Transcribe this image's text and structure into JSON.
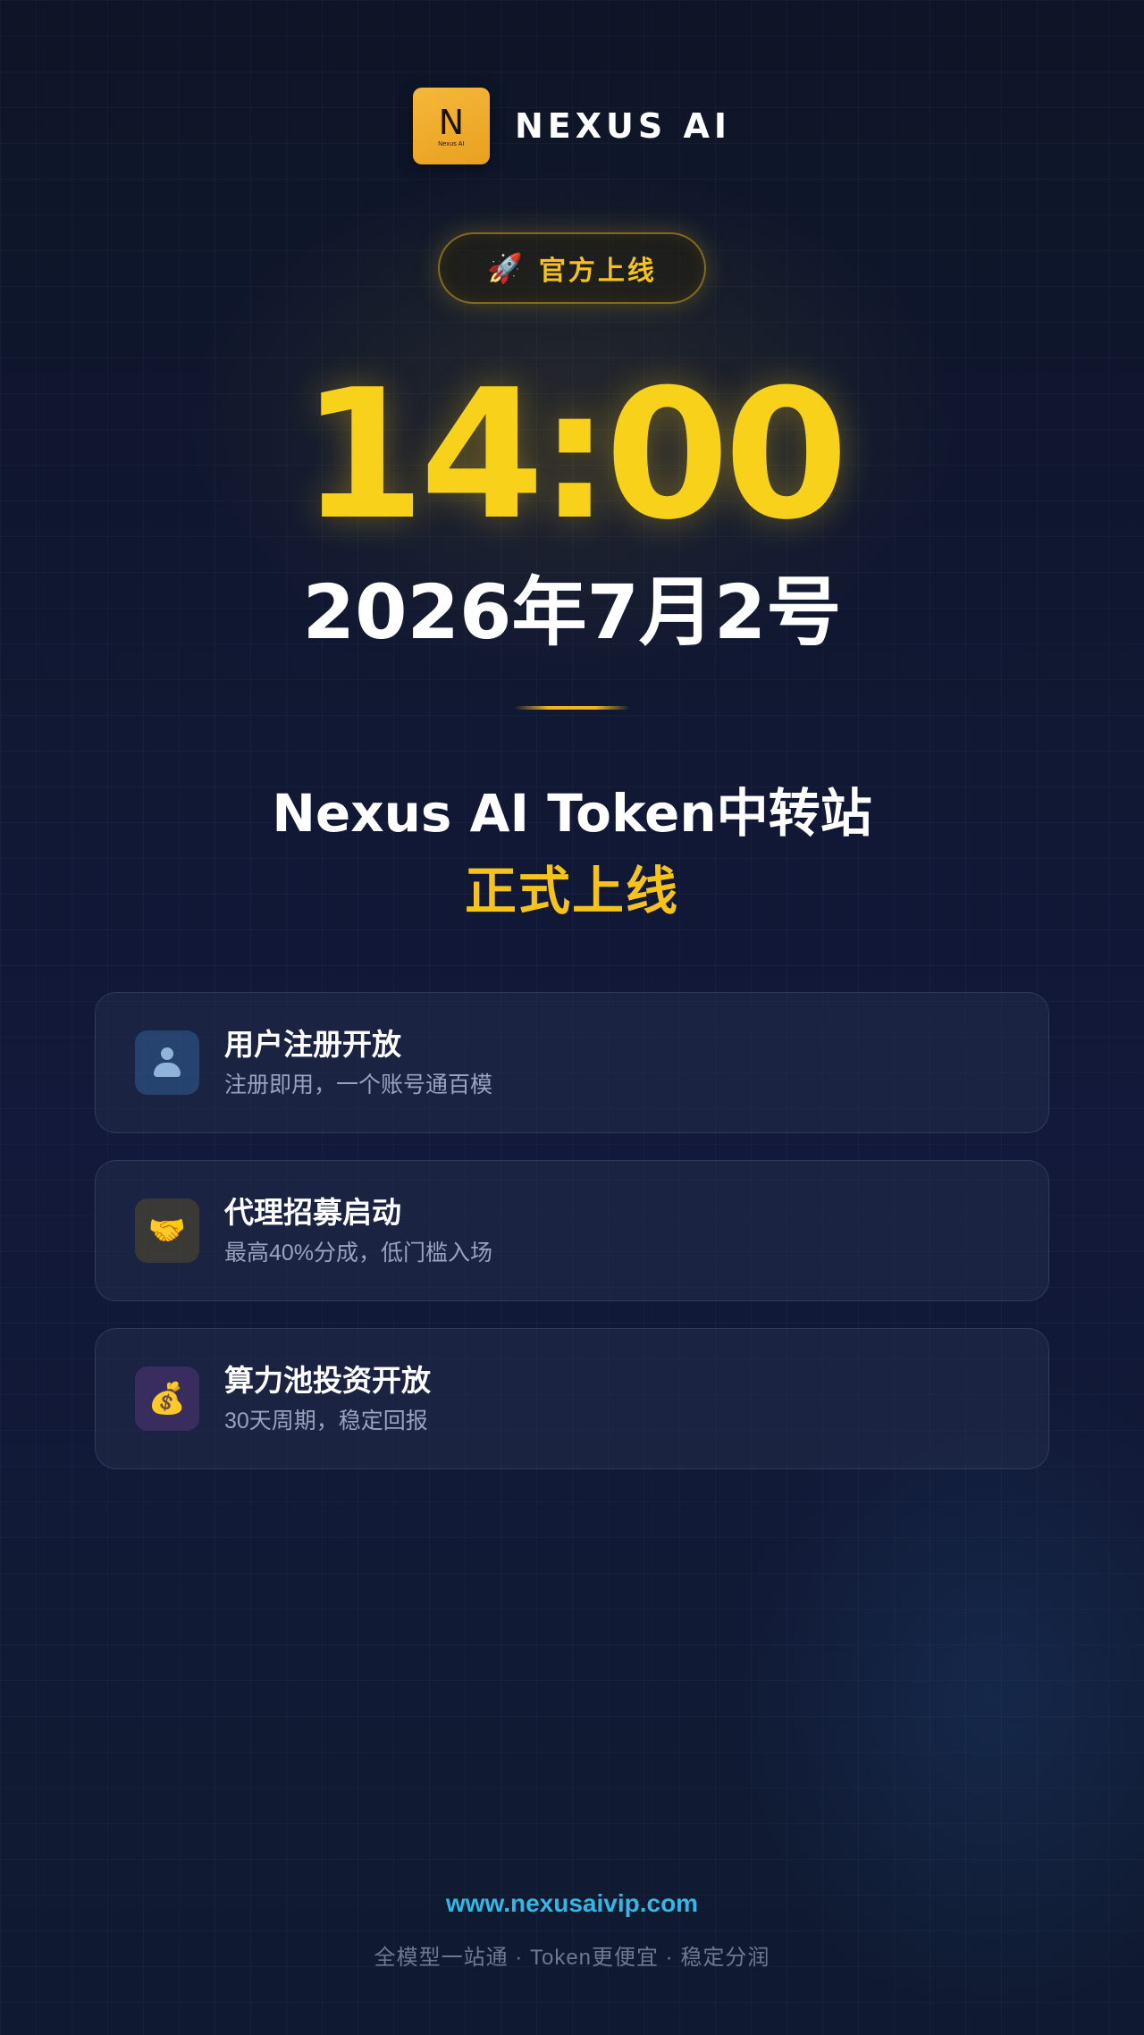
{
  "brand": {
    "logo_letter": "N",
    "logo_sub": "Nexus AI",
    "name": "NEXUS AI",
    "logo_color": "#F2AE2A"
  },
  "launch_badge": {
    "icon": "rocket-icon",
    "label": "官方上线"
  },
  "event": {
    "time": "14:00",
    "date": "2026年7月2号"
  },
  "headline": {
    "title": "Nexus AI Token中转站",
    "subtitle": "正式上线"
  },
  "features": [
    {
      "icon": "user-icon",
      "title": "用户注册开放",
      "description": "注册即用，一个账号通百模"
    },
    {
      "icon": "handshake-icon",
      "icon_glyph": "🤝",
      "title": "代理招募启动",
      "description": "最高40%分成，低门槛入场"
    },
    {
      "icon": "money-bag-icon",
      "icon_glyph": "💰",
      "title": "算力池投资开放",
      "description": "30天周期，稳定回报"
    }
  ],
  "footer": {
    "url": "www.nexusaivip.com",
    "tagline": "全模型一站通 · Token更便宜 · 稳定分润"
  },
  "colors": {
    "accent_yellow": "#F8D21A",
    "link_blue": "#35B7E6",
    "background": "#0E1628"
  }
}
